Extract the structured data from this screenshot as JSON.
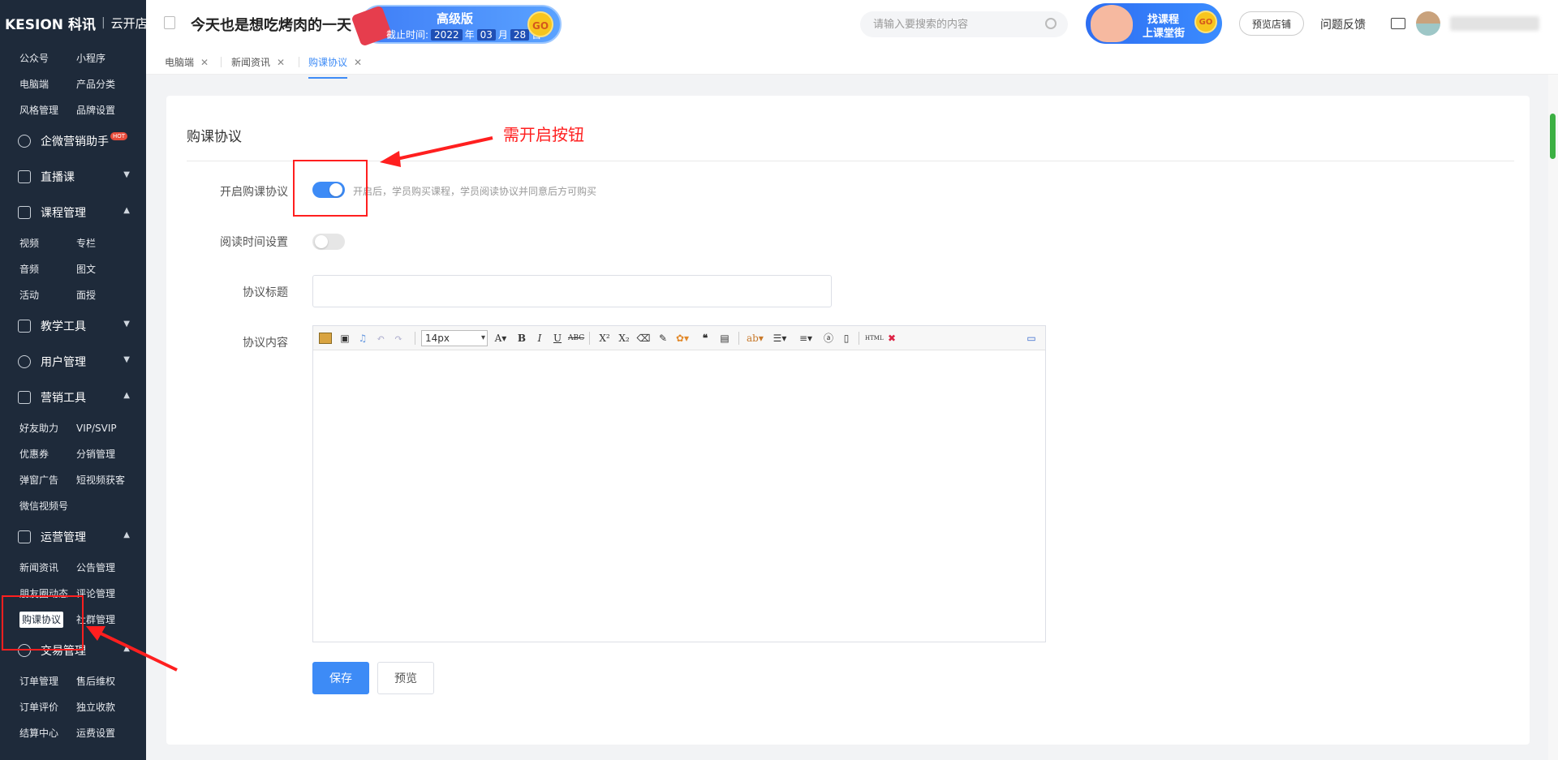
{
  "logo": {
    "brand": "KESION 科讯",
    "product": "云开店"
  },
  "sidebar": {
    "top_items": [
      "公众号",
      "小程序",
      "电脑端",
      "产品分类",
      "风格管理",
      "品牌设置"
    ],
    "groups": [
      {
        "title": "企微营销助手",
        "badge": "HOT",
        "items": []
      },
      {
        "title": "直播课",
        "items": []
      },
      {
        "title": "课程管理",
        "items": [
          "视频",
          "专栏",
          "音频",
          "图文",
          "活动",
          "面授"
        ]
      },
      {
        "title": "教学工具",
        "items": []
      },
      {
        "title": "用户管理",
        "items": []
      },
      {
        "title": "营销工具",
        "items": [
          "好友助力",
          "VIP/SVIP",
          "优惠券",
          "分销管理",
          "弹窗广告",
          "短视频获客",
          "微信视频号"
        ]
      },
      {
        "title": "运营管理",
        "items": [
          "新闻资讯",
          "公告管理",
          "朋友圈动态",
          "评论管理",
          "购课协议",
          "社群管理"
        ]
      },
      {
        "title": "交易管理",
        "items": [
          "订单管理",
          "售后维权",
          "订单评价",
          "独立收款",
          "结算中心",
          "运费设置"
        ]
      }
    ]
  },
  "header": {
    "shop_name": "今天也是想吃烤肉的一天",
    "version": {
      "name": "高级版",
      "expire_label": "截止时间:",
      "year": "2022",
      "year_unit": "年",
      "month": "03",
      "month_unit": "月",
      "day": "28",
      "day_unit": "日",
      "go": "GO"
    },
    "search_placeholder": "请输入要搜索的内容",
    "course_banner": {
      "line1": "找课程",
      "line2": "上课堂街",
      "go": "GO"
    },
    "preview_shop": "预览店铺",
    "feedback": "问题反馈"
  },
  "tabs": [
    {
      "label": "电脑端",
      "active": false
    },
    {
      "label": "新闻资讯",
      "active": false
    },
    {
      "label": "购课协议",
      "active": true
    }
  ],
  "page": {
    "title": "购课协议",
    "annotation": "需开启按钮",
    "enable_label": "开启购课协议",
    "enable_on": true,
    "enable_hint": "开启后，学员购买课程，学员阅读协议并同意后方可购买",
    "read_time_label": "阅读时间设置",
    "read_time_on": false,
    "agreement_title_label": "协议标题",
    "agreement_title_value": "",
    "agreement_content_label": "协议内容",
    "font_size": "14px",
    "save_label": "保存",
    "preview_label": "预览"
  },
  "colors": {
    "accent": "#3d8bf6",
    "sidebar_bg": "#1e2a3a",
    "annotation": "#ff1f1f"
  }
}
